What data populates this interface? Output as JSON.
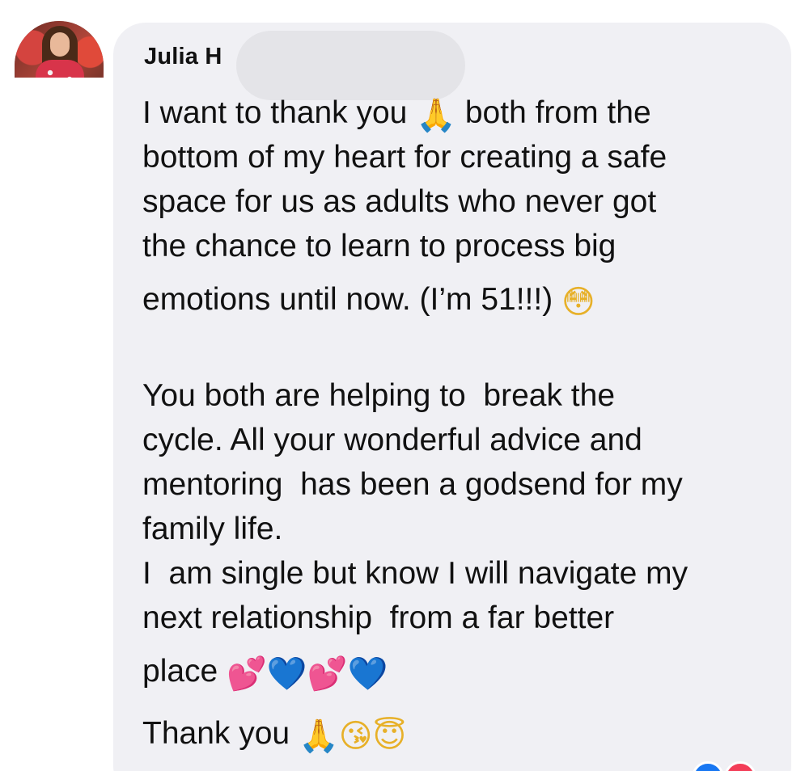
{
  "comment": {
    "author_name": "Julia H",
    "lines": [
      "I want to thank you ",
      " both from the",
      "bottom of my heart for creating a safe",
      "space for us as adults who never got",
      "the chance to learn to process big",
      "emotions until now. (I’m 51!!!) ",
      "You both are helping to  break the",
      "cycle. All your wonderful advice and",
      "mentoring  has been a godsend for my",
      "family life.",
      "I  am single but know I will navigate my",
      "next relationship  from a far better",
      "place ",
      "Thank you "
    ],
    "emojis": {
      "pray": "🙏",
      "flushed": "😳",
      "two_hearts": "💕",
      "blue_heart": "💙",
      "kiss": "😘",
      "halo": "😇"
    },
    "icon_names": [
      "folded-hands-icon",
      "flushed-face-icon",
      "two-hearts-icon",
      "blue-heart-icon",
      "kissing-face-icon",
      "smiling-halo-icon"
    ]
  },
  "colors": {
    "bubble": "#f0f0f4",
    "text": "#111111",
    "redaction": "#e4e4e8",
    "reaction_like": "#1877f2",
    "reaction_love": "#f33e58"
  }
}
